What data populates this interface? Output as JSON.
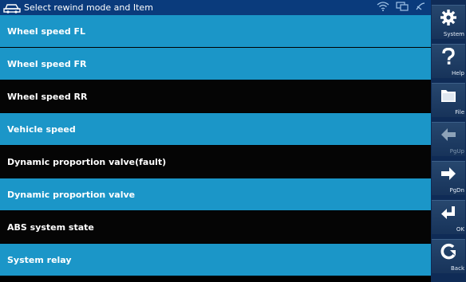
{
  "title_bar": {
    "title": "Select rewind mode and Item"
  },
  "rows": [
    {
      "label": "Wheel speed FL",
      "highlight": false
    },
    {
      "label": "Wheel speed FR",
      "highlight": false
    },
    {
      "label": "Wheel speed RR",
      "highlight": true
    },
    {
      "label": "Vehicle speed",
      "highlight": false
    },
    {
      "label": "Dynamic proportion valve(fault)",
      "highlight": true
    },
    {
      "label": "Dynamic proportion valve",
      "highlight": false
    },
    {
      "label": "ABS system state",
      "highlight": true
    },
    {
      "label": "System relay",
      "highlight": false
    }
  ],
  "sidebar": {
    "system": {
      "label": "System",
      "icon": "gear-icon"
    },
    "help": {
      "label": "Help",
      "icon": "question-icon"
    },
    "file": {
      "label": "File",
      "icon": "folder-icon"
    },
    "pgup": {
      "label": "PgUp",
      "icon": "arrow-left-icon",
      "enabled": false
    },
    "pgdn": {
      "label": "PgDn",
      "icon": "arrow-right-icon",
      "enabled": true
    },
    "ok": {
      "label": "OK",
      "icon": "enter-icon"
    },
    "back": {
      "label": "Back",
      "icon": "back-icon"
    }
  },
  "colors": {
    "row_normal": "#1b96c8",
    "row_selected": "#050505",
    "title_bar": "#0a3b7c",
    "sidebar": "#0f2b56"
  }
}
